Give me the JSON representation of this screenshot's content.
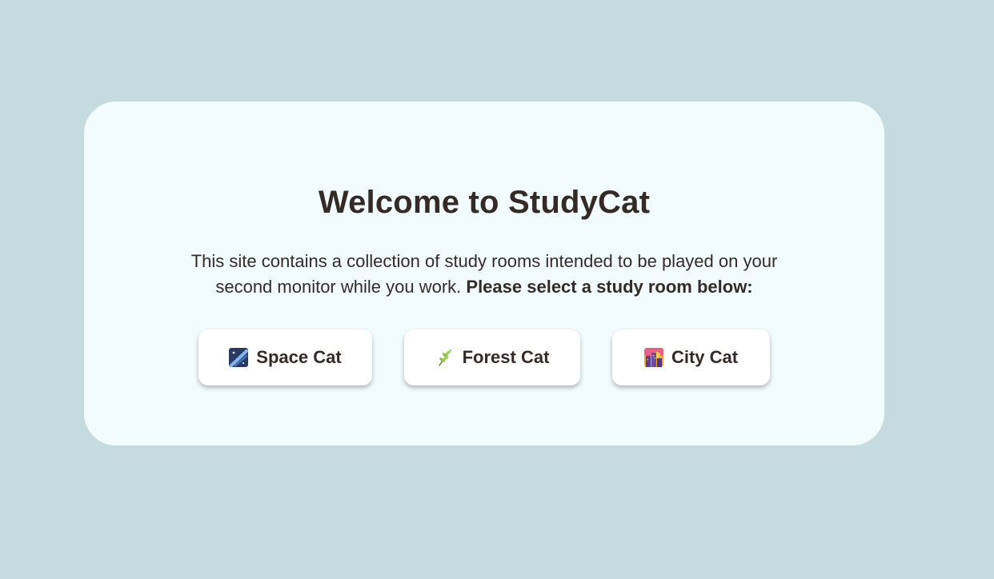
{
  "page": {
    "background_color": "#c5dbe0",
    "card_color": "#f3fcfd",
    "text_color": "#342b28"
  },
  "welcome": {
    "title": "Welcome to StudyCat",
    "description": "This site contains a collection of study rooms intended to be played on your second monitor while you work.",
    "description_emphasis": "Please select a study room below:"
  },
  "rooms": [
    {
      "label": "Space Cat",
      "icon": "space-icon"
    },
    {
      "label": "Forest Cat",
      "icon": "leaf-icon"
    },
    {
      "label": "City Cat",
      "icon": "city-icon"
    }
  ]
}
